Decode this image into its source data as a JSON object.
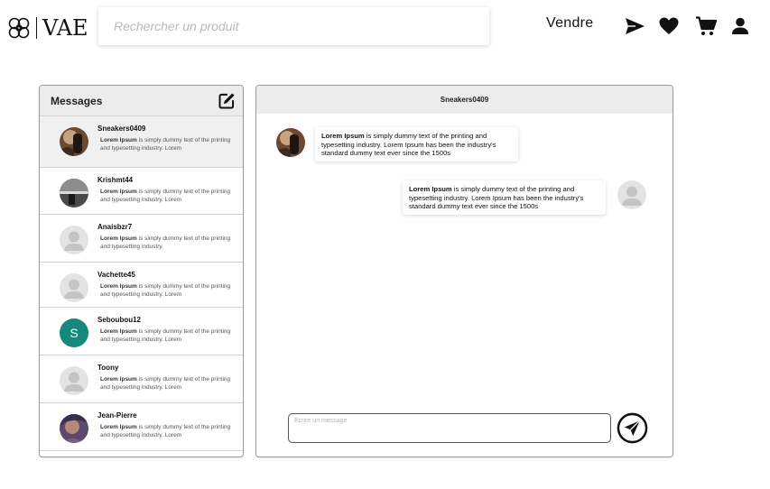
{
  "header": {
    "logo_text": "VAE",
    "search_placeholder": "Rechercher un produit",
    "sell_label": "Vendre",
    "icons": [
      "send-icon",
      "heart-icon",
      "cart-icon",
      "user-icon"
    ]
  },
  "messages_panel": {
    "title": "Messages",
    "compose_icon": "edit-icon",
    "conversations": [
      {
        "name": "Sneakers0409",
        "preview_bold": "Lorem Ipsum",
        "preview_rest": " is simply dummy text of the printing and typesetting industry. Lorem",
        "active": true
      },
      {
        "name": "Krishmt44",
        "preview_bold": "Lorem Ipsum",
        "preview_rest": " is simply dummy text of the printing and typesetting industry. Lorem",
        "active": false
      },
      {
        "name": "Anaisbzr7",
        "preview_bold": "Lorem Ipsum",
        "preview_rest": " is simply dummy text of the printing and typesetting industry.",
        "active": false
      },
      {
        "name": "Vachette45",
        "preview_bold": "Lorem Ipsum",
        "preview_rest": " is simply dummy text of the printing and typesetting industry. Lorem",
        "active": false
      },
      {
        "name": "Seboubou12",
        "preview_bold": "Lorem Ipsum",
        "preview_rest": " is simply dummy text of the printing and typesetting industry. Lorem",
        "active": false,
        "avatar_letter": "S"
      },
      {
        "name": "Toony",
        "preview_bold": "Lorem Ipsum",
        "preview_rest": " is simply dummy text of the printing and typesetting industry. Lorem",
        "active": false
      },
      {
        "name": "Jean-Pierre",
        "preview_bold": "Lorem Ipsum",
        "preview_rest": " is simply dummy text of the printing and typesetting industry. Lorem",
        "active": false
      }
    ]
  },
  "chat": {
    "title": "Sneakers0409",
    "messages": [
      {
        "from": "other",
        "bold": "Lorem Ipsum",
        "text": " is simply dummy text of the printing and typesetting industry. Lorem Ipsum has been the industry's standard dummy text ever since the 1500s"
      },
      {
        "from": "me",
        "bold": "Lorem Ipsum",
        "text": " is simply dummy text of the printing and typesetting industry. Lorem Ipsum has been the industry's standard dummy text ever since the 1500s"
      }
    ],
    "input_placeholder": "Ecrire un message",
    "send_icon": "send-circle-icon"
  },
  "colors": {
    "panel_header_bg": "#ececec",
    "active_row_bg": "#f0f0f0",
    "teal_avatar": "#17897a",
    "default_avatar_bg": "#e3e3e3",
    "default_avatar_fg": "#c4c4c4"
  }
}
